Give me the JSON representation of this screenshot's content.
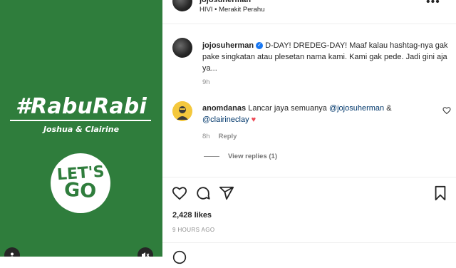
{
  "media": {
    "hashtag": "#RabuRabi",
    "couple_names": "Joshua & Clairine",
    "sticker_line1": "LET'S",
    "sticker_line2": "GO",
    "accent_color": "#2f7d3c"
  },
  "header": {
    "username": "jojosuherman",
    "subtitle": "HIVI • Merakit Perahu"
  },
  "caption": {
    "username": "jojosuherman",
    "text": "D-DAY! DREDEG-DAY! Maaf kalau hashtag-nya gak pake singkatan atau plesetan nama kami. Kami gak pede. Jadi gini aja ya...",
    "time": "9h"
  },
  "comment": {
    "username": "anomdanas",
    "text_before": "Lancar jaya semuanya ",
    "mention1": "@jojosuherman",
    "text_between": " &",
    "mention2": "@clairineclay",
    "emoji": "♥",
    "time": "8h",
    "reply_label": "Reply",
    "view_replies": "View replies (1)"
  },
  "post": {
    "likes": "2,428 likes",
    "time_ago": "9 HOURS AGO"
  },
  "icons": [
    "more-icon",
    "verified-icon",
    "like-icon",
    "comment-icon",
    "share-icon",
    "save-icon",
    "audio-icon",
    "tag-icon"
  ]
}
